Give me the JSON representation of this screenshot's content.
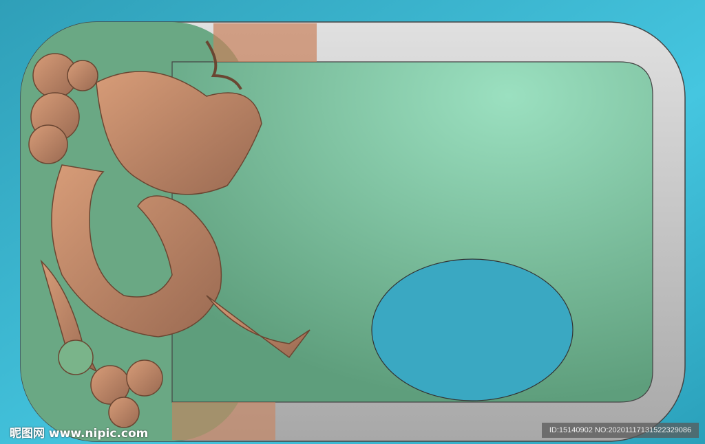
{
  "watermark": {
    "site": "昵图网 www.nipic.com",
    "id_text": "ID:15140902 NO:20201117131522329086"
  },
  "colors": {
    "background": "#3bb4cc",
    "frame": "#c8c8c8",
    "panel": "#7fc4a0",
    "ellipse": "#3aa8c2",
    "dragon": "#c08a6a"
  }
}
